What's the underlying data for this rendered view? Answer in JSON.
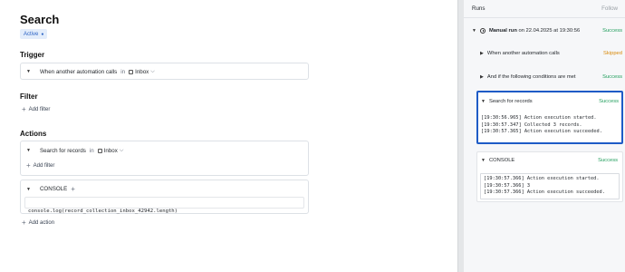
{
  "page": {
    "title": "Search",
    "status_badge": "Active",
    "badge_dot": "●"
  },
  "trigger": {
    "section_title": "Trigger",
    "label": "When another automation calls",
    "in": "in",
    "target": "Inbox"
  },
  "filter": {
    "section_title": "Filter",
    "add_label": "Add filter"
  },
  "actions": {
    "section_title": "Actions",
    "search": {
      "label": "Search for records",
      "in": "in",
      "target": "Inbox",
      "add_filter": "Add filter"
    },
    "console": {
      "label": "CONSOLE",
      "code_prefix": "console.log(",
      "code_var": "record_collection_inbox_42942",
      "code_suffix": ".length)"
    },
    "add_action": "Add action"
  },
  "runs": {
    "header": "Runs",
    "follow": "Follow",
    "run_prefix": "Manual run",
    "run_on": "on 22.04.2025 at 19:30:56",
    "run_status": "Success",
    "steps": [
      {
        "label": "When another automation calls",
        "status": "Skipped"
      },
      {
        "label": "And if the following conditions are met",
        "status": "Success"
      }
    ],
    "search_step": {
      "label": "Search for records",
      "status": "Success",
      "logs": [
        "[19:30:56.965] Action execution started.",
        "[19:30:57.347] Collected 3 records.",
        "[19:30:57.365] Action execution succeeded."
      ]
    },
    "console_step": {
      "label": "CONSOLE",
      "status": "Success",
      "logs": [
        "[19:30:57.366] Action execution started.",
        "[19:30:57.366] 3",
        "[19:30:57.366] Action execution succeeded."
      ]
    }
  },
  "colors": {
    "accent": "#1e5bc6",
    "success": "#1f9d5b",
    "skipped": "#d98a0b"
  }
}
